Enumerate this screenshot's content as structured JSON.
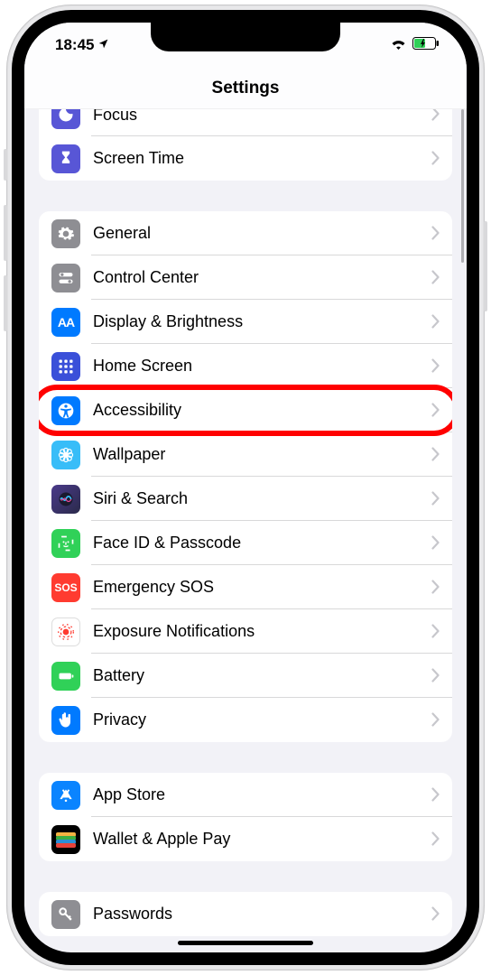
{
  "statusbar": {
    "time": "18:45",
    "location_arrow": "↖"
  },
  "header": {
    "title": "Settings"
  },
  "groups": [
    {
      "first": true,
      "rows": [
        {
          "id": "focus",
          "label": "Focus",
          "icon_bg": "#5856d6",
          "glyph": "moon",
          "partial_top": true
        },
        {
          "id": "screen-time",
          "label": "Screen Time",
          "icon_bg": "#5856d6",
          "glyph": "hourglass"
        }
      ]
    },
    {
      "rows": [
        {
          "id": "general",
          "label": "General",
          "icon_bg": "#8e8e93",
          "glyph": "gear"
        },
        {
          "id": "control-center",
          "label": "Control Center",
          "icon_bg": "#8e8e93",
          "glyph": "switches"
        },
        {
          "id": "display-brightness",
          "label": "Display & Brightness",
          "icon_bg": "#007aff",
          "glyph": "aa"
        },
        {
          "id": "home-screen",
          "label": "Home Screen",
          "icon_bg": "#3a50d9",
          "glyph": "grid"
        },
        {
          "id": "accessibility",
          "label": "Accessibility",
          "icon_bg": "#007aff",
          "glyph": "accessibility",
          "highlight": true
        },
        {
          "id": "wallpaper",
          "label": "Wallpaper",
          "icon_bg": "#38bdf8",
          "glyph": "flower"
        },
        {
          "id": "siri-search",
          "label": "Siri & Search",
          "icon_bg": "gradient-siri",
          "glyph": "siri"
        },
        {
          "id": "faceid-passcode",
          "label": "Face ID & Passcode",
          "icon_bg": "#30d158",
          "glyph": "faceid"
        },
        {
          "id": "emergency-sos",
          "label": "Emergency SOS",
          "icon_bg": "#ff3b30",
          "glyph": "sos"
        },
        {
          "id": "exposure-notifications",
          "label": "Exposure Notifications",
          "icon_bg": "#ffffff",
          "glyph": "exposure"
        },
        {
          "id": "battery",
          "label": "Battery",
          "icon_bg": "#30d158",
          "glyph": "battery"
        },
        {
          "id": "privacy",
          "label": "Privacy",
          "icon_bg": "#007aff",
          "glyph": "hand"
        }
      ]
    },
    {
      "rows": [
        {
          "id": "app-store",
          "label": "App Store",
          "icon_bg": "#0a84ff",
          "glyph": "appstore"
        },
        {
          "id": "wallet-apple-pay",
          "label": "Wallet & Apple Pay",
          "icon_bg": "#000000",
          "glyph": "wallet"
        }
      ]
    },
    {
      "rows": [
        {
          "id": "passwords",
          "label": "Passwords",
          "icon_bg": "#8e8e93",
          "glyph": "key"
        }
      ]
    }
  ]
}
